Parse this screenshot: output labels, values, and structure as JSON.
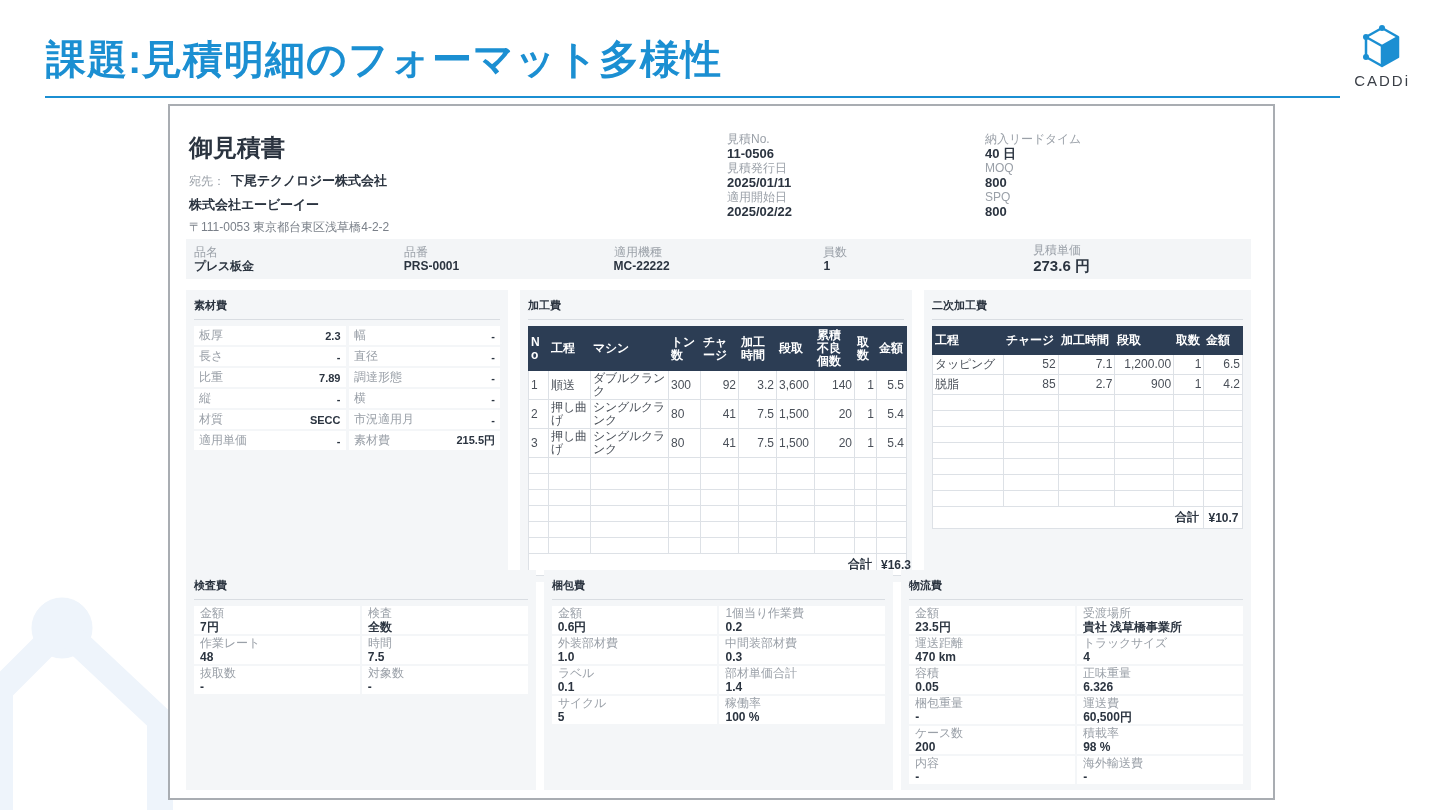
{
  "slide": {
    "title": "課題:見積明細のフォーマット多様性",
    "logo": "CADDi"
  },
  "quote": {
    "title": "御見積書",
    "recipient_label": "宛先：",
    "recipient": "下尾テクノロジー株式会社",
    "issuer": "株式会社エービーイー",
    "address": "〒111-0053 東京都台東区浅草橋4-2-2",
    "meta_columns": [
      [
        {
          "label": "見積No.",
          "value": "11-0506"
        },
        {
          "label": "見積発行日",
          "value": "2025/01/11"
        },
        {
          "label": "適用開始日",
          "value": "2025/02/22"
        }
      ],
      [
        {
          "label": "納入リードタイム",
          "value": "40 日"
        },
        {
          "label": "MOQ",
          "value": "800"
        },
        {
          "label": "SPQ",
          "value": "800"
        }
      ]
    ],
    "summary": [
      {
        "label": "品名",
        "value": "プレス板金",
        "kind": "normal"
      },
      {
        "label": "品番",
        "value": "PRS-0001",
        "kind": "normal"
      },
      {
        "label": "適用機種",
        "value": "MC-22222",
        "kind": "normal"
      },
      {
        "label": "員数",
        "value": "1",
        "kind": "normal"
      },
      {
        "label": "見積単価",
        "value": "273.6 円",
        "kind": "large"
      }
    ],
    "material": {
      "title": "素材費",
      "fields": [
        {
          "label": "板厚",
          "value": "2.3"
        },
        {
          "label": "幅",
          "value": "-"
        },
        {
          "label": "長さ",
          "value": "-"
        },
        {
          "label": "直径",
          "value": "-"
        },
        {
          "label": "比重",
          "value": "7.89"
        },
        {
          "label": "調達形態",
          "value": "-"
        },
        {
          "label": "縦",
          "value": "-"
        },
        {
          "label": "横",
          "value": "-"
        },
        {
          "label": "材質",
          "value": "SECC"
        },
        {
          "label": "市況適用月",
          "value": "-"
        },
        {
          "label": "適用単価",
          "value": "-"
        },
        {
          "label": "素材費",
          "value": "215.5円"
        }
      ]
    },
    "processing": {
      "title": "加工費",
      "columns": [
        {
          "label": "No"
        },
        {
          "label": "工程"
        },
        {
          "label": "マシン"
        },
        {
          "label": "トン数"
        },
        {
          "label": "チャージ"
        },
        {
          "label": "加工時間"
        },
        {
          "label": "段取"
        },
        {
          "label": "累積不良個数"
        },
        {
          "label": "取数"
        },
        {
          "label": "金額"
        }
      ],
      "rows": [
        [
          "1",
          "順送",
          "ダブルクランク",
          "300",
          "92",
          "3.2",
          "3,600",
          "140",
          "1",
          "5.5"
        ],
        [
          "2",
          "押し曲げ",
          "シングルクランク",
          "80",
          "41",
          "7.5",
          "1,500",
          "20",
          "1",
          "5.4"
        ],
        [
          "3",
          "押し曲げ",
          "シングルクランク",
          "80",
          "41",
          "7.5",
          "1,500",
          "20",
          "1",
          "5.4"
        ]
      ],
      "total_label": "合計",
      "total": "¥16.3"
    },
    "secondary": {
      "title": "二次加工費",
      "columns": [
        {
          "label": "工程"
        },
        {
          "label": "チャージ"
        },
        {
          "label": "加工時間"
        },
        {
          "label": "段取"
        },
        {
          "label": "取数"
        },
        {
          "label": "金額"
        }
      ],
      "rows": [
        [
          "タッピング",
          "52",
          "7.1",
          "1,200.00",
          "1",
          "6.5"
        ],
        [
          "脱脂",
          "85",
          "2.7",
          "900",
          "1",
          "4.2"
        ]
      ],
      "total_label": "合計",
      "total": "¥10.7"
    },
    "bottom_panels": [
      {
        "title": "検査費",
        "fields": [
          {
            "label": "金額",
            "value": "7円"
          },
          {
            "label": "検査",
            "value": "全数"
          },
          {
            "label": "作業レート",
            "value": "48"
          },
          {
            "label": "時間",
            "value": "7.5"
          },
          {
            "label": "抜取数",
            "value": "-"
          },
          {
            "label": "対象数",
            "value": "-"
          }
        ]
      },
      {
        "title": "梱包費",
        "fields": [
          {
            "label": "金額",
            "value": "0.6円"
          },
          {
            "label": "1個当り作業費",
            "value": "0.2"
          },
          {
            "label": "外装部材費",
            "value": "1.0"
          },
          {
            "label": "中間装部材費",
            "value": "0.3"
          },
          {
            "label": "ラベル",
            "value": "0.1"
          },
          {
            "label": "部材単価合計",
            "value": "1.4"
          },
          {
            "label": "サイクル",
            "value": "5"
          },
          {
            "label": "稼働率",
            "value": "100 %"
          }
        ]
      },
      {
        "title": "物流費",
        "fields": [
          {
            "label": "金額",
            "value": "23.5円"
          },
          {
            "label": "受渡場所",
            "value": "貴社 浅草橋事業所"
          },
          {
            "label": "運送距離",
            "value": "470 km"
          },
          {
            "label": "トラックサイズ",
            "value": "4"
          },
          {
            "label": "容積",
            "value": "0.05"
          },
          {
            "label": "正味重量",
            "value": "6.326"
          },
          {
            "label": "梱包重量",
            "value": "-"
          },
          {
            "label": "運送費",
            "value": "60,500円"
          },
          {
            "label": "ケース数",
            "value": "200"
          },
          {
            "label": "積載率",
            "value": "98 %"
          },
          {
            "label": "内容",
            "value": "-"
          },
          {
            "label": "海外輸送費",
            "value": "-"
          }
        ]
      }
    ]
  }
}
